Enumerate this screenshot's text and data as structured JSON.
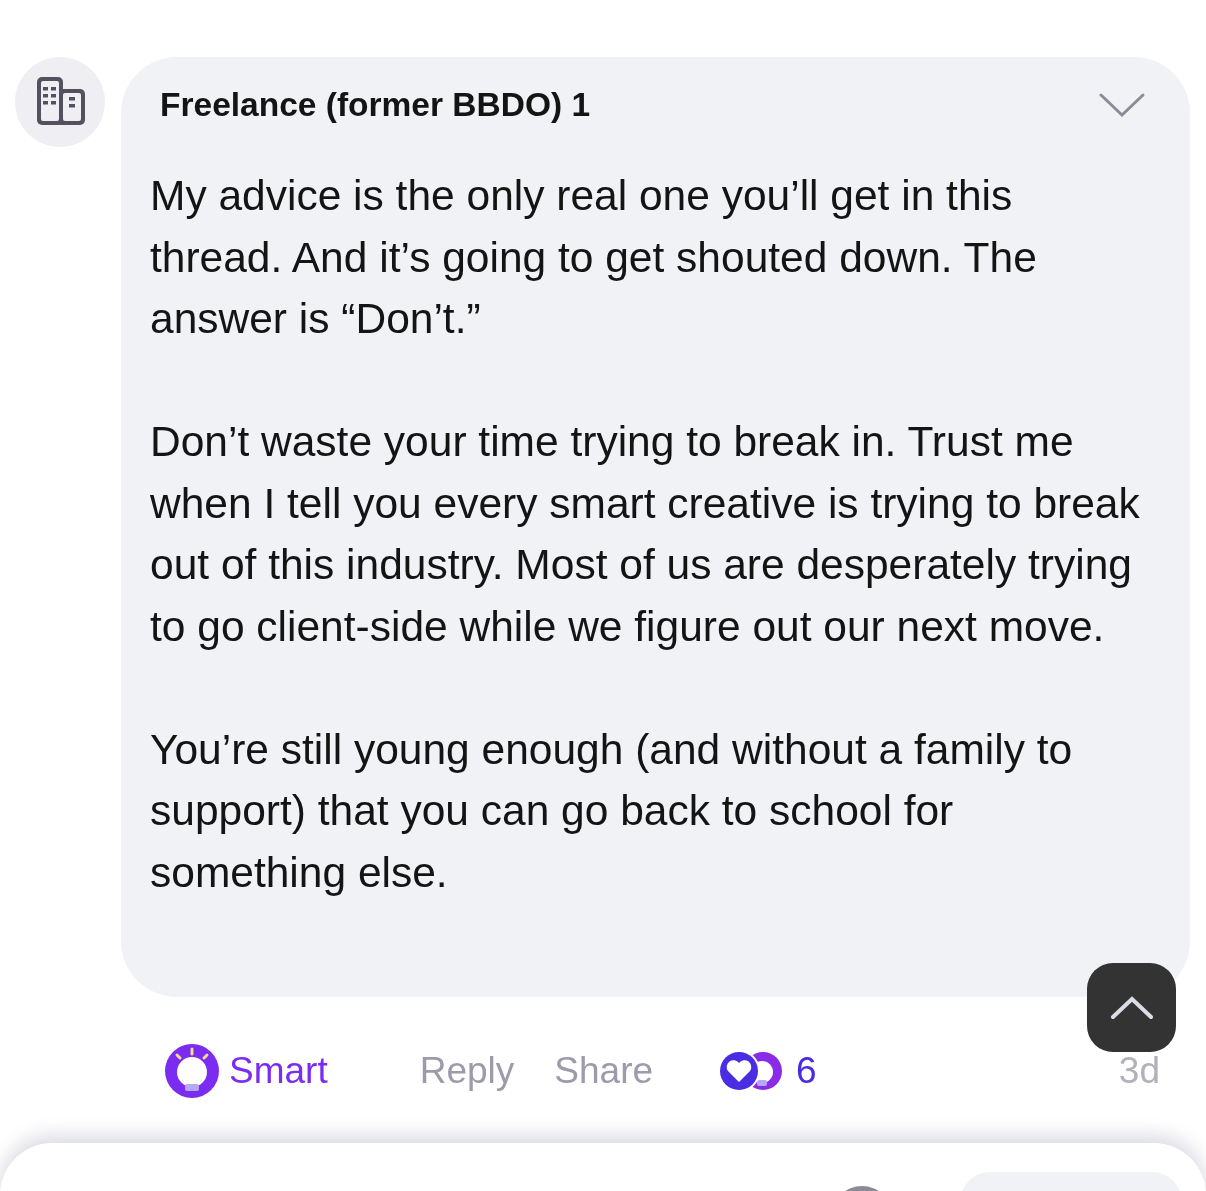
{
  "post": {
    "author": "Freelance (former BBDO) 1",
    "paragraphs": [
      "My advice is the only real one you’ll get in this thread. And it’s going to get shouted down. The answer is “Don’t.”",
      "Don’t waste your time trying to break in. Trust me when I tell you every smart creative is trying to break out of this industry. Most of us are desperately trying to go client-side while we figure out our next move.",
      "You’re still young enough (and without a family to support) that you can go back to school for something else."
    ]
  },
  "actions": {
    "smart": "Smart",
    "reply": "Reply",
    "share": "Share",
    "reaction_count": "6",
    "age": "3d"
  }
}
